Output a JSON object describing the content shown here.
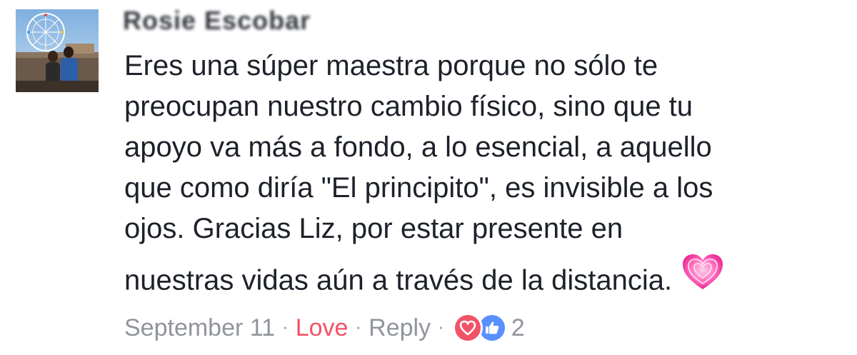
{
  "comment": {
    "author_name": "Rosie Escobar",
    "body_lines": [
      "Eres una súper maestra porque no sólo te",
      "preocupan nuestro cambio físico, sino que tu",
      "apoyo va más a fondo, a lo esencial, a aquello",
      "que como diría \"El principito\", es invisible a los",
      "ojos. Gracias Liz,  por estar presente en",
      "nuestras vidas aún a través de la distancia."
    ],
    "emoji": "growing-heart-icon"
  },
  "meta": {
    "timestamp": "September 11",
    "separator": "·",
    "love_label": "Love",
    "reply_label": "Reply",
    "reaction_count": "2",
    "reactions": [
      "love-reaction-icon",
      "like-reaction-icon"
    ]
  },
  "colors": {
    "text": "#1d2129",
    "meta_gray": "#90949c",
    "love_red": "#f25268",
    "like_blue": "#5890ff",
    "emoji_pink": "#ff3fa0"
  }
}
